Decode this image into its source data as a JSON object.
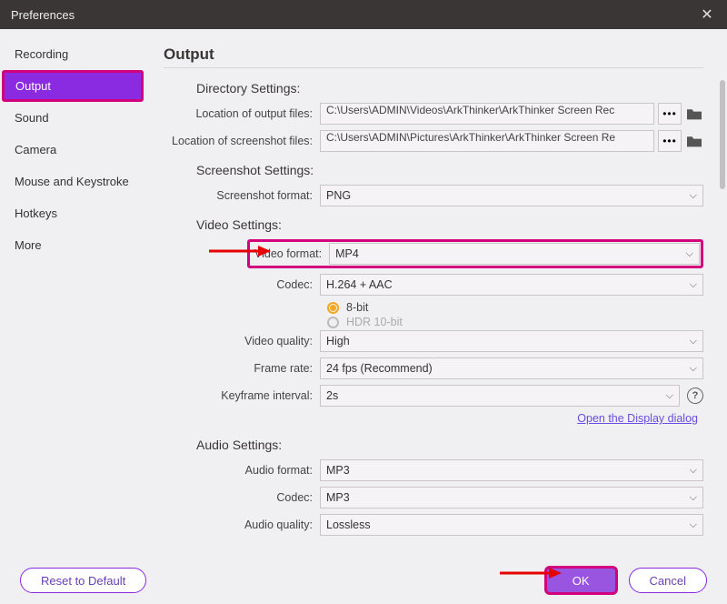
{
  "window": {
    "title": "Preferences"
  },
  "sidebar": {
    "items": [
      {
        "label": "Recording"
      },
      {
        "label": "Output"
      },
      {
        "label": "Sound"
      },
      {
        "label": "Camera"
      },
      {
        "label": "Mouse and Keystroke"
      },
      {
        "label": "Hotkeys"
      },
      {
        "label": "More"
      }
    ],
    "active_index": 1
  },
  "page": {
    "heading": "Output",
    "directory": {
      "title": "Directory Settings:",
      "output_label": "Location of output files:",
      "output_path": "C:\\Users\\ADMIN\\Videos\\ArkThinker\\ArkThinker Screen Rec",
      "screenshot_label": "Location of screenshot files:",
      "screenshot_path": "C:\\Users\\ADMIN\\Pictures\\ArkThinker\\ArkThinker Screen Re"
    },
    "screenshot": {
      "title": "Screenshot Settings:",
      "format_label": "Screenshot format:",
      "format_value": "PNG"
    },
    "video": {
      "title": "Video Settings:",
      "format_label": "Video format:",
      "format_value": "MP4",
      "codec_label": "Codec:",
      "codec_value": "H.264 + AAC",
      "bit8": "8-bit",
      "hdr10": "HDR 10-bit",
      "quality_label": "Video quality:",
      "quality_value": "High",
      "framerate_label": "Frame rate:",
      "framerate_value": "24 fps (Recommend)",
      "keyframe_label": "Keyframe interval:",
      "keyframe_value": "2s",
      "display_link": "Open the Display dialog"
    },
    "audio": {
      "title": "Audio Settings:",
      "format_label": "Audio format:",
      "format_value": "MP3",
      "codec_label": "Codec:",
      "codec_value": "MP3",
      "quality_label": "Audio quality:",
      "quality_value": "Lossless"
    }
  },
  "footer": {
    "reset": "Reset to Default",
    "ok": "OK",
    "cancel": "Cancel"
  }
}
